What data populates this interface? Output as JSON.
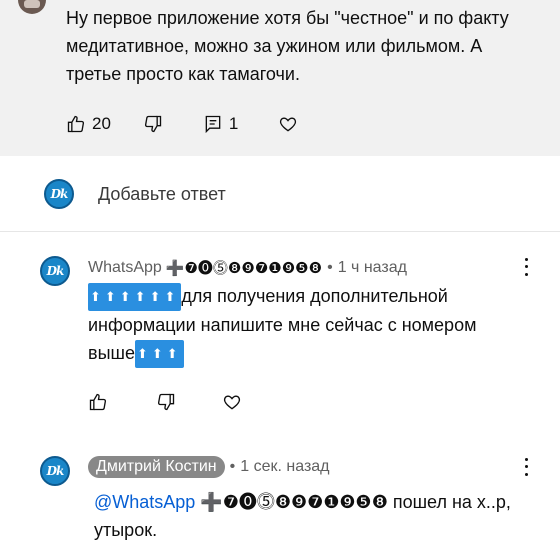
{
  "top_comment": {
    "text": "Ну первое приложение хотя бы \"честное\" и по факту медитативное,  можно за ужином или фильмом. А третье просто как тамагочи.",
    "likes": "20",
    "replies": "1"
  },
  "reply_box": {
    "avatar_text": "Dk",
    "placeholder": "Добавьте ответ"
  },
  "comments": [
    {
      "avatar_text": "Dk",
      "author": "WhatsApp",
      "author_badge": "➕❼⓿⓹❽❾❼❶❾❺❽",
      "time": "1 ч назад",
      "arrows_prefix": "⬆⬆⬆⬆⬆⬆",
      "body": "для получения дополнительной информации напишите мне сейчас с номером выше",
      "arrows_suffix": "⬆⬆⬆"
    },
    {
      "avatar_text": "Dk",
      "author": "Дмитрий Костин",
      "time": "1 сек. назад",
      "mention": "@WhatsApp",
      "mention_badge": "➕❼⓿⓹❽❾❼❶❾❺❽",
      "body": " пошел на х..р, утырок."
    }
  ],
  "colors": {
    "top_bg": "#f1f1f1",
    "avatar_bg": "#1a86c8",
    "mention": "#065fd4",
    "author_chip": "#888888"
  }
}
